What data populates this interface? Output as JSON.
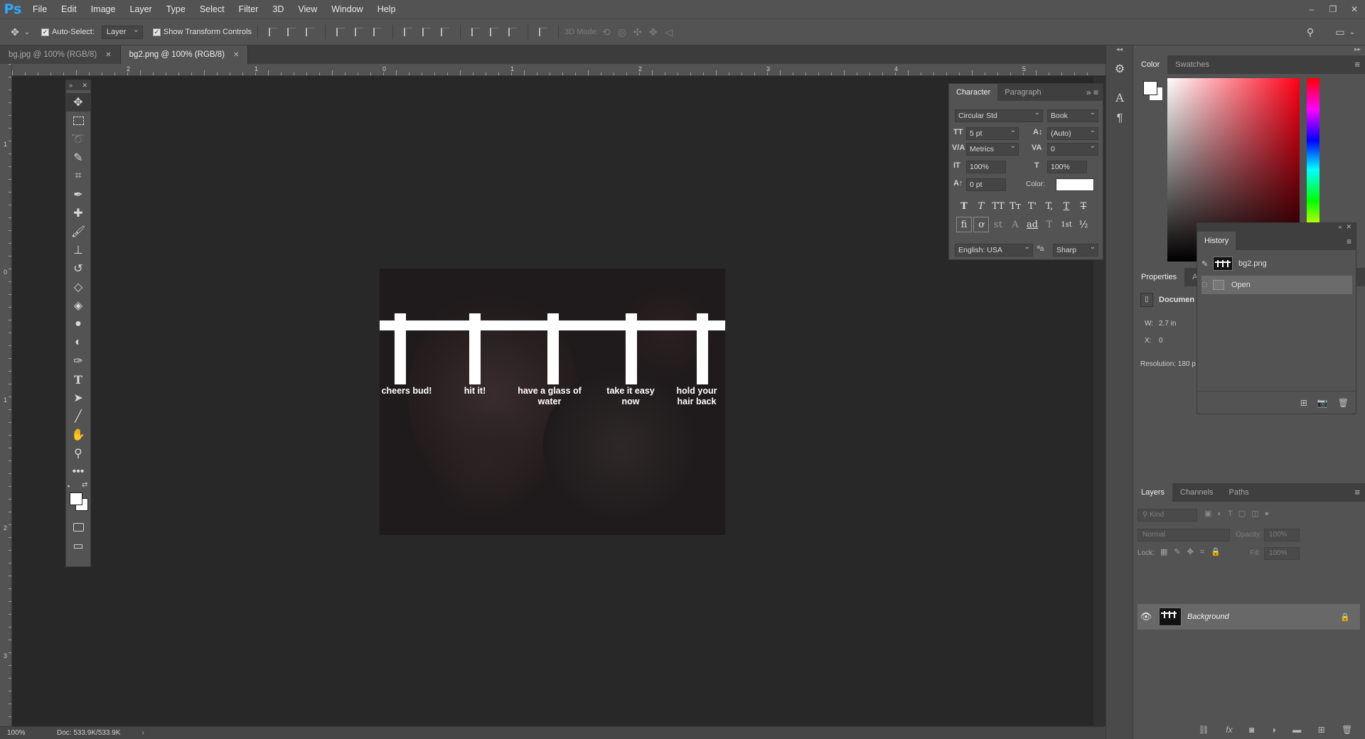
{
  "app": {
    "logo": "Ps"
  },
  "menu": [
    "File",
    "Edit",
    "Image",
    "Layer",
    "Type",
    "Select",
    "Filter",
    "3D",
    "View",
    "Window",
    "Help"
  ],
  "window_controls": [
    "–",
    "❐",
    "✕"
  ],
  "options_bar": {
    "auto_select_label": "Auto-Select:",
    "auto_select_value": "Layer",
    "transform_label": "Show Transform Controls",
    "mode_3d_label": "3D Mode:"
  },
  "tabs": [
    {
      "label": "bg.jpg @ 100% (RGB/8)",
      "active": false
    },
    {
      "label": "bg2.png @ 100% (RGB/8)",
      "active": true
    }
  ],
  "ruler": {
    "h_labels": [
      "2",
      "1",
      "0",
      "1",
      "2",
      "3",
      "4",
      "5"
    ],
    "v_labels": [
      "1",
      "0",
      "1",
      "2",
      "3"
    ]
  },
  "canvas": {
    "labels": [
      "cheers bud!",
      "hit it!",
      "have a glass of water",
      "take it easy now",
      "hold your hair back"
    ]
  },
  "character": {
    "tabs": [
      "Character",
      "Paragraph"
    ],
    "font_family": "Circular Std",
    "font_style": "Book",
    "size": "5 pt",
    "leading": "(Auto)",
    "kerning": "Metrics",
    "tracking": "0",
    "vscale": "100%",
    "hscale": "100%",
    "baseline": "0 pt",
    "color_label": "Color:",
    "language": "English: USA",
    "aa_label": "ªa",
    "antialias": "Sharp",
    "style_buttons": [
      "T",
      "T",
      "TT",
      "Tт",
      "T'",
      "T,",
      "T",
      "T"
    ],
    "opentype_buttons": [
      "fi",
      "ơ",
      "st",
      "A",
      "ad",
      "T",
      "1st",
      "½"
    ]
  },
  "color_panel": {
    "tabs": [
      "Color",
      "Swatches"
    ]
  },
  "history": {
    "title": "History",
    "snapshot_label": "bg2.png",
    "rows": [
      "Open"
    ]
  },
  "properties": {
    "tabs": [
      "Properties",
      "Ad"
    ],
    "doc_label": "Documen",
    "w_label": "W:",
    "w_value": "2.7 in",
    "x_label": "X:",
    "x_value": "0",
    "resolution": "Resolution: 180 p"
  },
  "layers": {
    "tabs": [
      "Layers",
      "Channels",
      "Paths"
    ],
    "kind_placeholder": "Kind",
    "blend_mode": "Normal",
    "opacity_label": "Opacity:",
    "opacity_value": "100%",
    "lock_label": "Lock:",
    "fill_label": "Fill:",
    "fill_value": "100%",
    "layer_name": "Background",
    "footer_icons": [
      "link-icon",
      "fx-icon",
      "mask-icon",
      "adjustment-icon",
      "group-icon",
      "new-layer-icon",
      "trash-icon"
    ]
  },
  "status": {
    "zoom": "100%",
    "doc": "Doc: 533.9K/533.9K"
  }
}
